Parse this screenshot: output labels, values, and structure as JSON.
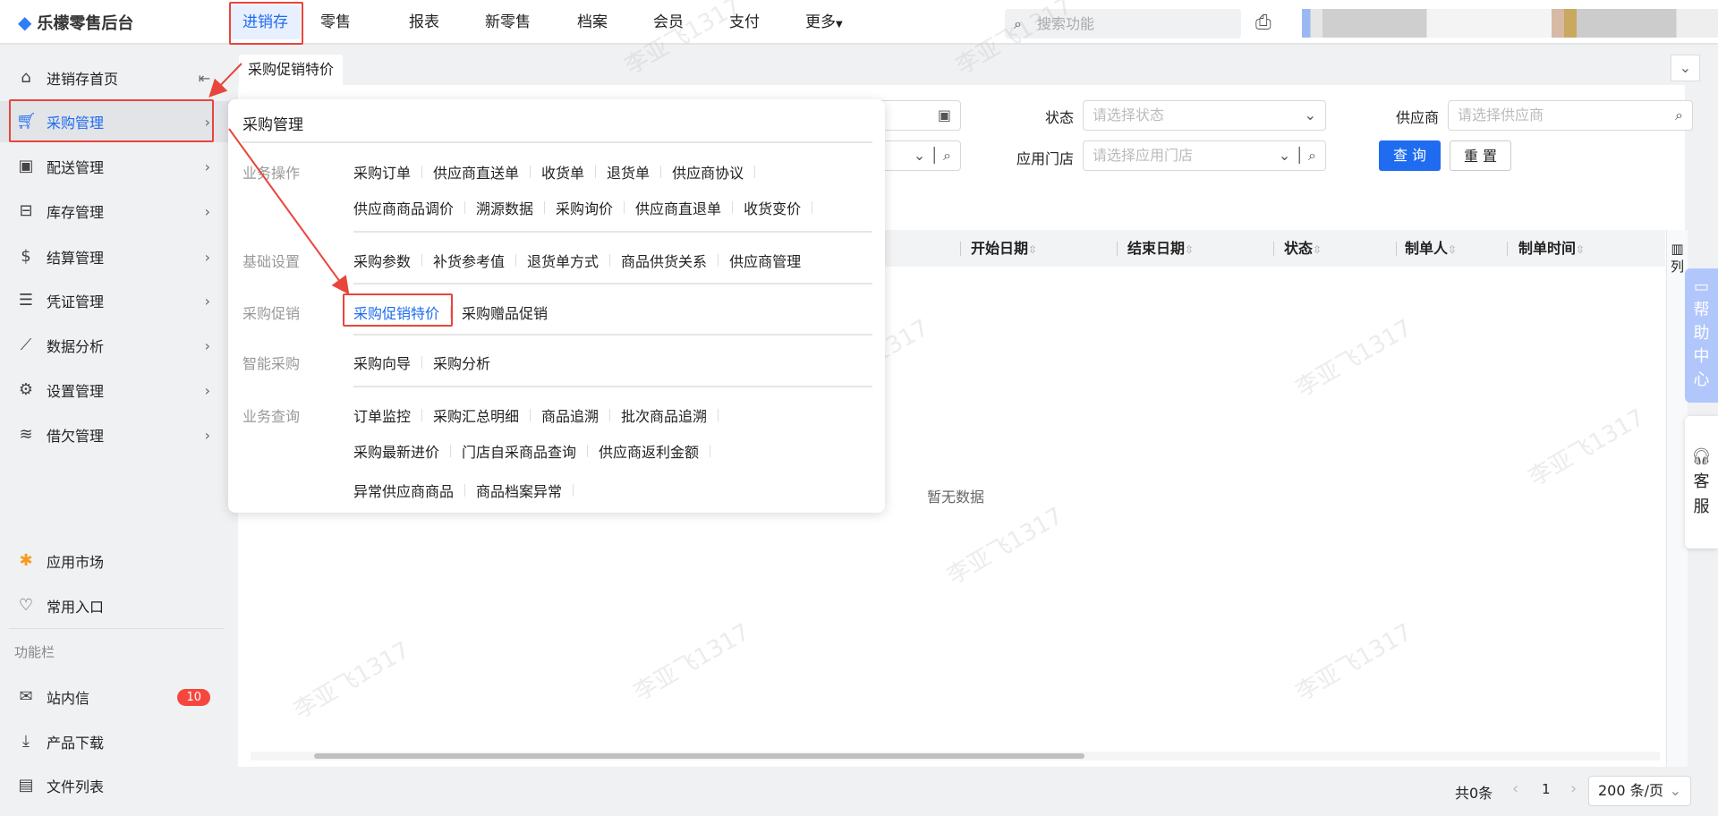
{
  "app": {
    "title": "乐檬零售后台"
  },
  "topnav": {
    "items": [
      "进销存",
      "零售",
      "报表",
      "新零售",
      "档案",
      "会员",
      "支付",
      "更多"
    ],
    "active": "进销存",
    "search_placeholder": "搜索功能"
  },
  "sidebar": {
    "items": [
      "进销存首页",
      "采购管理",
      "配送管理",
      "库存管理",
      "结算管理",
      "凭证管理",
      "数据分析",
      "设置管理",
      "借欠管理"
    ],
    "selected": "采购管理",
    "bottom": [
      "应用市场",
      "常用入口"
    ],
    "section_label": "功能栏",
    "tools": [
      "站内信",
      "产品下载",
      "文件列表"
    ],
    "inbox_count": "10"
  },
  "tab": {
    "label": "采购促销特价"
  },
  "filters": {
    "status_label": "状态",
    "status_placeholder": "请选择状态",
    "supplier_label": "供应商",
    "supplier_placeholder": "请选择供应商",
    "store_label": "应用门店",
    "store_placeholder": "请选择应用门店",
    "query": "查 询",
    "reset": "重 置"
  },
  "table": {
    "columns": [
      "开始日期",
      "结束日期",
      "状态",
      "制单人",
      "制单时间"
    ],
    "column_setting": "列",
    "empty": "暂无数据"
  },
  "pagination": {
    "total": "共0条",
    "page": "1",
    "page_size": "200 条/页"
  },
  "menu": {
    "title": "采购管理",
    "groups": [
      {
        "label": "业务操作",
        "rows": [
          [
            "采购订单",
            "供应商直送单",
            "收货单",
            "退货单",
            "供应商协议"
          ],
          [
            "供应商商品调价",
            "溯源数据",
            "采购询价",
            "供应商直退单",
            "收货变价"
          ]
        ]
      },
      {
        "label": "基础设置",
        "rows": [
          [
            "采购参数",
            "补货参考值",
            "退货单方式",
            "商品供货关系",
            "供应商管理"
          ]
        ]
      },
      {
        "label": "采购促销",
        "rows": [
          [
            "采购促销特价",
            "采购赠品促销"
          ]
        ]
      },
      {
        "label": "智能采购",
        "rows": [
          [
            "采购向导",
            "采购分析"
          ]
        ]
      },
      {
        "label": "业务查询",
        "rows": [
          [
            "订单监控",
            "采购汇总明细",
            "商品追溯",
            "批次商品追溯"
          ],
          [
            "采购最新进价",
            "门店自采商品查询",
            "供应商返利金额"
          ],
          [
            "异常供应商商品",
            "商品档案异常"
          ]
        ]
      }
    ],
    "highlighted": "采购促销特价"
  },
  "side_widgets": {
    "help": "帮助中心",
    "service": "客服"
  },
  "watermark": "李亚飞1317",
  "colors": {
    "accent": "#1f6cf0",
    "annotation": "#e8453c",
    "badge": "#f5473d"
  }
}
